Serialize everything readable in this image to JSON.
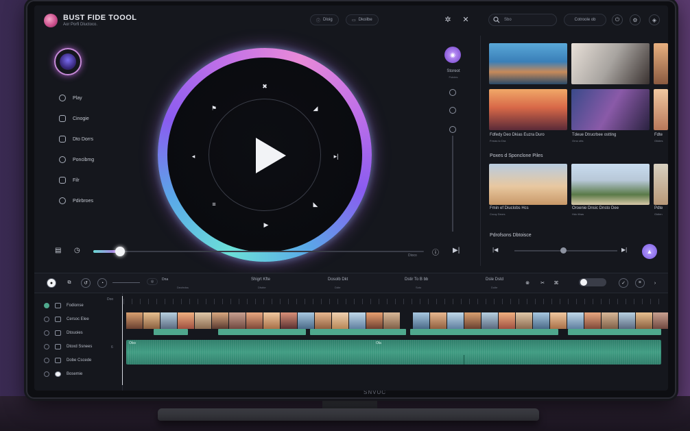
{
  "app": {
    "title": "BUST FIDE TOOOL",
    "subtitle": "Aor Porfi Dluctoco."
  },
  "header": {
    "pill_left": "Dloig",
    "pill_right": "Dkoilbe",
    "search_placeholder": "Sbo",
    "chip_label": "Cotroole ob"
  },
  "sidebar": {
    "items": [
      {
        "label": "Play"
      },
      {
        "label": "Cinogie"
      },
      {
        "label": "Dto Dorrs"
      },
      {
        "label": "Poncibmg"
      },
      {
        "label": "Filr"
      },
      {
        "label": "Pdirbroes"
      }
    ]
  },
  "player": {
    "time_label": "Dioco",
    "progress_percent": 8
  },
  "volume": {
    "label": "Storeot",
    "sublabel": "Fsbdes"
  },
  "library": {
    "row1_caption_a": "Fdfedy Deo Dkias Euzra Duro",
    "row1_sub_a": "Frmas to Dra",
    "row1_caption_b": "Tdeue Dtrucrbee ostting",
    "row1_sub_b": "Orno otts",
    "row1_caption_c": "Fdte",
    "row1_sub_c": "Gtidies",
    "section2_title": "Poxes d Sponclone Piles",
    "row2_caption_a": "Fmin ef Diuclobs Hcs",
    "row2_sub_a": "Crouy Deors",
    "row2_caption_b": "Oroenie Dnsic Dnsto Dee",
    "row2_sub_b": "Hdo tthas",
    "row2_caption_c": "Pdte",
    "row2_sub_c": "Gidlen",
    "section3_title": "Pdrofsons Dbtoisce",
    "mini_progress_percent": 47
  },
  "timeline": {
    "toggle_chip": "Dna",
    "groups": [
      {
        "label": "Shigrt Kfte",
        "sub": "Dfsbte"
      },
      {
        "label": "Dosolb Dkt",
        "sub": "Ddte"
      },
      {
        "label": "Dstir To B bb",
        "sub": "Soto"
      },
      {
        "label": "Dsle Dstd",
        "sub": "Dolte"
      }
    ],
    "left_sub_label": "Deofedss",
    "top_counter": "Doo",
    "tracks": [
      {
        "label": "Fodionse"
      },
      {
        "label": "Cersoc Elee"
      },
      {
        "label": "Dtouoies"
      },
      {
        "label": "Dtoxd Ssnees"
      },
      {
        "label": "Dobe Cscede"
      },
      {
        "label": "Bosemie"
      }
    ],
    "track_num": "6",
    "clip_label_1": "Olss",
    "clip_label_2": "Ola"
  },
  "brand": "SNVUC",
  "colors": {
    "accent_purple": "#b96ae8",
    "accent_teal": "#6ad8d2",
    "clip_green": "#4fa88d",
    "bg": "#15171d"
  }
}
